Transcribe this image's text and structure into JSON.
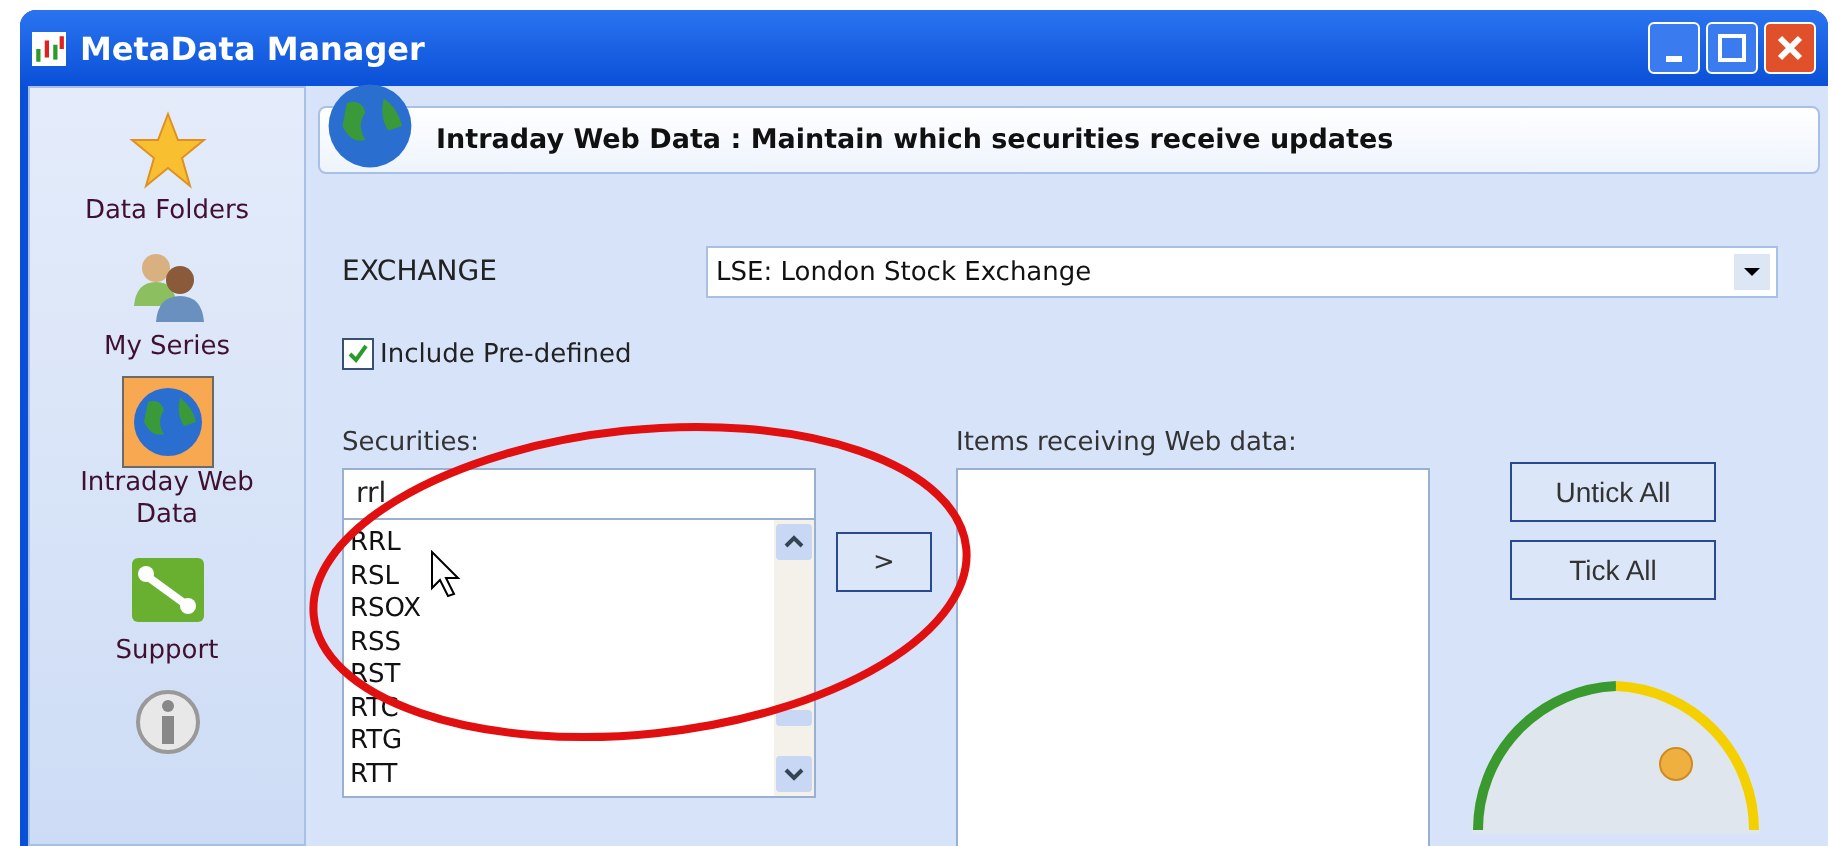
{
  "window": {
    "title": "MetaData Manager"
  },
  "sidebar": {
    "items": [
      {
        "label": "Data Folders",
        "kind": "star",
        "selected": false
      },
      {
        "label": "My Series",
        "kind": "people",
        "selected": false
      },
      {
        "label": "Intraday Web Data",
        "kind": "globe",
        "selected": true
      },
      {
        "label": "Support",
        "kind": "wrench",
        "selected": false
      },
      {
        "kind": "info",
        "selected": false
      }
    ]
  },
  "header": {
    "title": "Intraday Web Data : Maintain which securities receive updates"
  },
  "exchange": {
    "label": "EXCHANGE",
    "value": "LSE: London Stock Exchange"
  },
  "include_predefined": {
    "label": "Include Pre-defined",
    "checked": true
  },
  "securities": {
    "label": "Securities:",
    "search": "rrl",
    "items": [
      "RRL",
      "RSL",
      "RSOX",
      "RSS",
      "RST",
      "RTC",
      "RTG",
      "RTT"
    ]
  },
  "move_button": ">",
  "web_items": {
    "label": "Items receiving Web data:"
  },
  "buttons": [
    "Untick All",
    "Tick All"
  ]
}
